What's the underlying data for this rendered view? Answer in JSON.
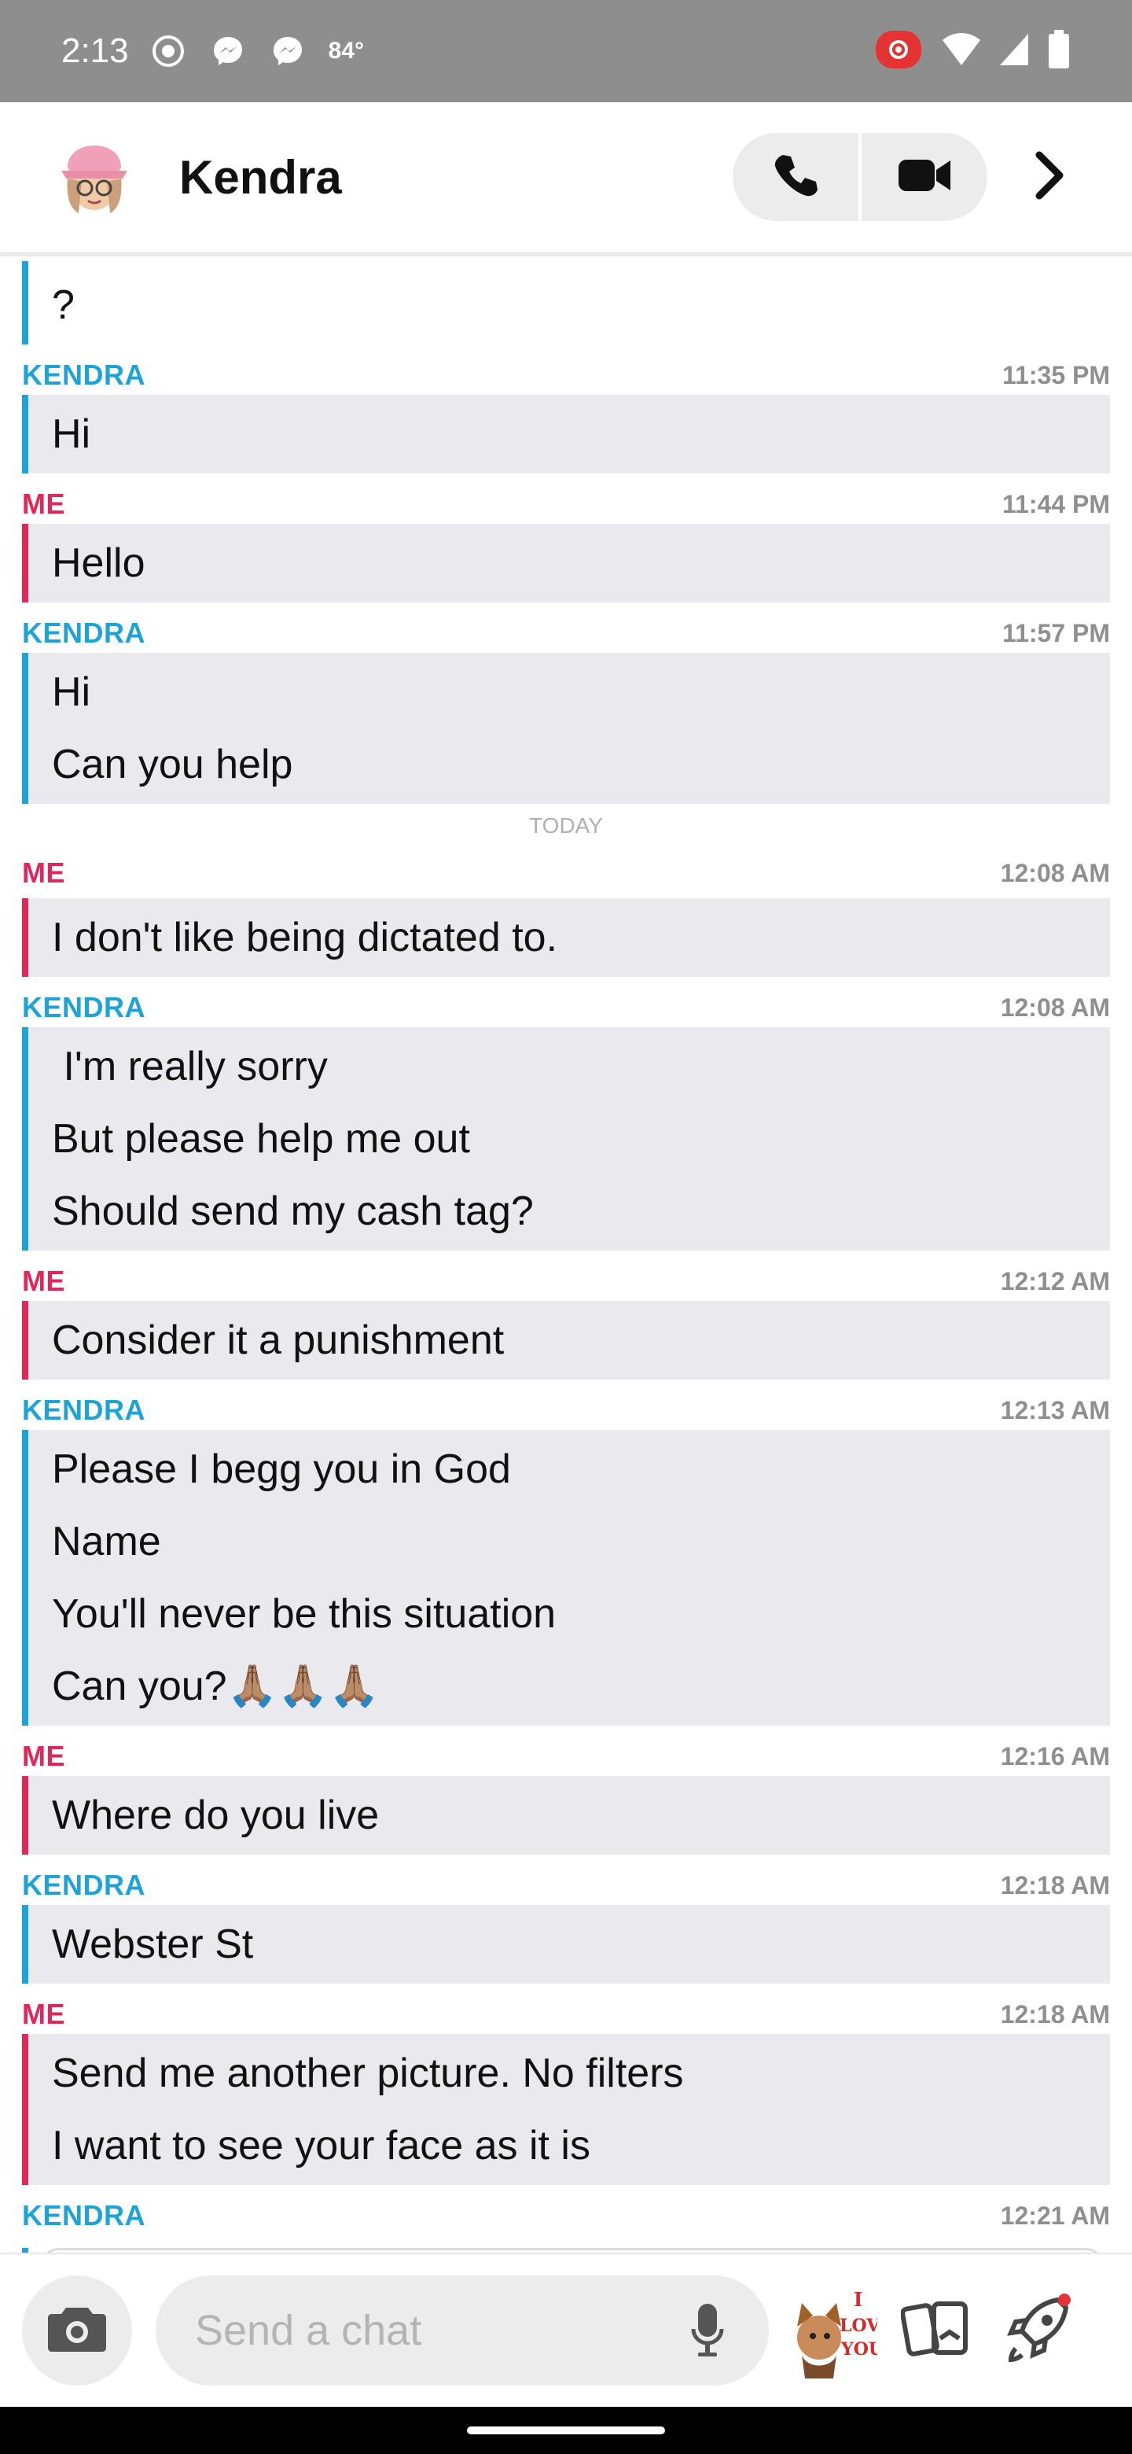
{
  "status_bar": {
    "time": "2:13",
    "temperature": "84°",
    "icons": [
      "screen-record-icon",
      "messenger-icon",
      "messenger-icon",
      "cast-icon",
      "wifi-icon",
      "signal-icon",
      "battery-icon"
    ]
  },
  "header": {
    "contact_name": "Kendra",
    "icons": [
      "phone-icon",
      "video-icon",
      "chevron-right-icon"
    ]
  },
  "chat": {
    "first_line": "?",
    "divider": "TODAY",
    "messages": [
      {
        "sender": "KENDRA",
        "time": "11:35 PM",
        "lines": [
          "Hi"
        ]
      },
      {
        "sender": "ME",
        "time": "11:44 PM",
        "lines": [
          "Hello"
        ]
      },
      {
        "sender": "KENDRA",
        "time": "11:57 PM",
        "lines": [
          "Hi",
          "Can you help"
        ]
      },
      {
        "sender": "ME",
        "time": "12:08 AM",
        "lines": [
          "I don't like being dictated to."
        ]
      },
      {
        "sender": "KENDRA",
        "time": "12:08 AM",
        "lines": [
          " I'm really sorry",
          "But please help me out",
          "Should send my cash tag?"
        ]
      },
      {
        "sender": "ME",
        "time": "12:12 AM",
        "lines": [
          "Consider it a punishment"
        ]
      },
      {
        "sender": "KENDRA",
        "time": "12:13 AM",
        "lines": [
          "Please I begg you in God",
          "Name",
          "You'll never be this situation",
          "Can you?🙏🏽🙏🏽🙏🏽"
        ]
      },
      {
        "sender": "ME",
        "time": "12:16 AM",
        "lines": [
          "Where do you live"
        ]
      },
      {
        "sender": "KENDRA",
        "time": "12:18 AM",
        "lines": [
          "Webster St"
        ]
      },
      {
        "sender": "ME",
        "time": "12:18 AM",
        "lines": [
          "Send me another picture. No filters",
          "I want to see your face as it is"
        ]
      },
      {
        "sender": "KENDRA",
        "time": "12:21 AM",
        "lines": []
      }
    ]
  },
  "input_bar": {
    "placeholder": "Send a chat",
    "sticker_text": "I LOVE YOU",
    "icons": [
      "camera-icon",
      "microphone-icon",
      "bitmoji-sticker",
      "cards-icon",
      "rocket-icon"
    ]
  },
  "colors": {
    "kendra": "#1ea3d6",
    "me": "#e0275a",
    "bubble_bg": "#eaeaee",
    "status_bar_bg": "#8e8e8e"
  }
}
